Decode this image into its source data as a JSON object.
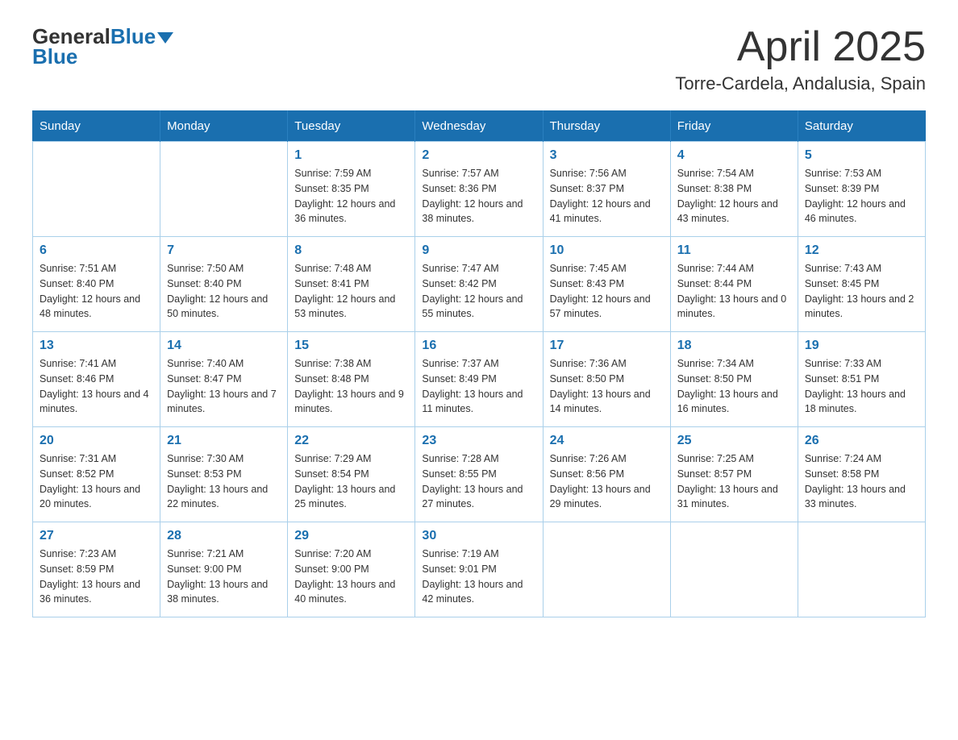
{
  "header": {
    "logo_general": "General",
    "logo_blue": "Blue",
    "title": "April 2025",
    "subtitle": "Torre-Cardela, Andalusia, Spain"
  },
  "days_of_week": [
    "Sunday",
    "Monday",
    "Tuesday",
    "Wednesday",
    "Thursday",
    "Friday",
    "Saturday"
  ],
  "weeks": [
    [
      {
        "day": "",
        "sunrise": "",
        "sunset": "",
        "daylight": ""
      },
      {
        "day": "",
        "sunrise": "",
        "sunset": "",
        "daylight": ""
      },
      {
        "day": "1",
        "sunrise": "Sunrise: 7:59 AM",
        "sunset": "Sunset: 8:35 PM",
        "daylight": "Daylight: 12 hours and 36 minutes."
      },
      {
        "day": "2",
        "sunrise": "Sunrise: 7:57 AM",
        "sunset": "Sunset: 8:36 PM",
        "daylight": "Daylight: 12 hours and 38 minutes."
      },
      {
        "day": "3",
        "sunrise": "Sunrise: 7:56 AM",
        "sunset": "Sunset: 8:37 PM",
        "daylight": "Daylight: 12 hours and 41 minutes."
      },
      {
        "day": "4",
        "sunrise": "Sunrise: 7:54 AM",
        "sunset": "Sunset: 8:38 PM",
        "daylight": "Daylight: 12 hours and 43 minutes."
      },
      {
        "day": "5",
        "sunrise": "Sunrise: 7:53 AM",
        "sunset": "Sunset: 8:39 PM",
        "daylight": "Daylight: 12 hours and 46 minutes."
      }
    ],
    [
      {
        "day": "6",
        "sunrise": "Sunrise: 7:51 AM",
        "sunset": "Sunset: 8:40 PM",
        "daylight": "Daylight: 12 hours and 48 minutes."
      },
      {
        "day": "7",
        "sunrise": "Sunrise: 7:50 AM",
        "sunset": "Sunset: 8:40 PM",
        "daylight": "Daylight: 12 hours and 50 minutes."
      },
      {
        "day": "8",
        "sunrise": "Sunrise: 7:48 AM",
        "sunset": "Sunset: 8:41 PM",
        "daylight": "Daylight: 12 hours and 53 minutes."
      },
      {
        "day": "9",
        "sunrise": "Sunrise: 7:47 AM",
        "sunset": "Sunset: 8:42 PM",
        "daylight": "Daylight: 12 hours and 55 minutes."
      },
      {
        "day": "10",
        "sunrise": "Sunrise: 7:45 AM",
        "sunset": "Sunset: 8:43 PM",
        "daylight": "Daylight: 12 hours and 57 minutes."
      },
      {
        "day": "11",
        "sunrise": "Sunrise: 7:44 AM",
        "sunset": "Sunset: 8:44 PM",
        "daylight": "Daylight: 13 hours and 0 minutes."
      },
      {
        "day": "12",
        "sunrise": "Sunrise: 7:43 AM",
        "sunset": "Sunset: 8:45 PM",
        "daylight": "Daylight: 13 hours and 2 minutes."
      }
    ],
    [
      {
        "day": "13",
        "sunrise": "Sunrise: 7:41 AM",
        "sunset": "Sunset: 8:46 PM",
        "daylight": "Daylight: 13 hours and 4 minutes."
      },
      {
        "day": "14",
        "sunrise": "Sunrise: 7:40 AM",
        "sunset": "Sunset: 8:47 PM",
        "daylight": "Daylight: 13 hours and 7 minutes."
      },
      {
        "day": "15",
        "sunrise": "Sunrise: 7:38 AM",
        "sunset": "Sunset: 8:48 PM",
        "daylight": "Daylight: 13 hours and 9 minutes."
      },
      {
        "day": "16",
        "sunrise": "Sunrise: 7:37 AM",
        "sunset": "Sunset: 8:49 PM",
        "daylight": "Daylight: 13 hours and 11 minutes."
      },
      {
        "day": "17",
        "sunrise": "Sunrise: 7:36 AM",
        "sunset": "Sunset: 8:50 PM",
        "daylight": "Daylight: 13 hours and 14 minutes."
      },
      {
        "day": "18",
        "sunrise": "Sunrise: 7:34 AM",
        "sunset": "Sunset: 8:50 PM",
        "daylight": "Daylight: 13 hours and 16 minutes."
      },
      {
        "day": "19",
        "sunrise": "Sunrise: 7:33 AM",
        "sunset": "Sunset: 8:51 PM",
        "daylight": "Daylight: 13 hours and 18 minutes."
      }
    ],
    [
      {
        "day": "20",
        "sunrise": "Sunrise: 7:31 AM",
        "sunset": "Sunset: 8:52 PM",
        "daylight": "Daylight: 13 hours and 20 minutes."
      },
      {
        "day": "21",
        "sunrise": "Sunrise: 7:30 AM",
        "sunset": "Sunset: 8:53 PM",
        "daylight": "Daylight: 13 hours and 22 minutes."
      },
      {
        "day": "22",
        "sunrise": "Sunrise: 7:29 AM",
        "sunset": "Sunset: 8:54 PM",
        "daylight": "Daylight: 13 hours and 25 minutes."
      },
      {
        "day": "23",
        "sunrise": "Sunrise: 7:28 AM",
        "sunset": "Sunset: 8:55 PM",
        "daylight": "Daylight: 13 hours and 27 minutes."
      },
      {
        "day": "24",
        "sunrise": "Sunrise: 7:26 AM",
        "sunset": "Sunset: 8:56 PM",
        "daylight": "Daylight: 13 hours and 29 minutes."
      },
      {
        "day": "25",
        "sunrise": "Sunrise: 7:25 AM",
        "sunset": "Sunset: 8:57 PM",
        "daylight": "Daylight: 13 hours and 31 minutes."
      },
      {
        "day": "26",
        "sunrise": "Sunrise: 7:24 AM",
        "sunset": "Sunset: 8:58 PM",
        "daylight": "Daylight: 13 hours and 33 minutes."
      }
    ],
    [
      {
        "day": "27",
        "sunrise": "Sunrise: 7:23 AM",
        "sunset": "Sunset: 8:59 PM",
        "daylight": "Daylight: 13 hours and 36 minutes."
      },
      {
        "day": "28",
        "sunrise": "Sunrise: 7:21 AM",
        "sunset": "Sunset: 9:00 PM",
        "daylight": "Daylight: 13 hours and 38 minutes."
      },
      {
        "day": "29",
        "sunrise": "Sunrise: 7:20 AM",
        "sunset": "Sunset: 9:00 PM",
        "daylight": "Daylight: 13 hours and 40 minutes."
      },
      {
        "day": "30",
        "sunrise": "Sunrise: 7:19 AM",
        "sunset": "Sunset: 9:01 PM",
        "daylight": "Daylight: 13 hours and 42 minutes."
      },
      {
        "day": "",
        "sunrise": "",
        "sunset": "",
        "daylight": ""
      },
      {
        "day": "",
        "sunrise": "",
        "sunset": "",
        "daylight": ""
      },
      {
        "day": "",
        "sunrise": "",
        "sunset": "",
        "daylight": ""
      }
    ]
  ]
}
